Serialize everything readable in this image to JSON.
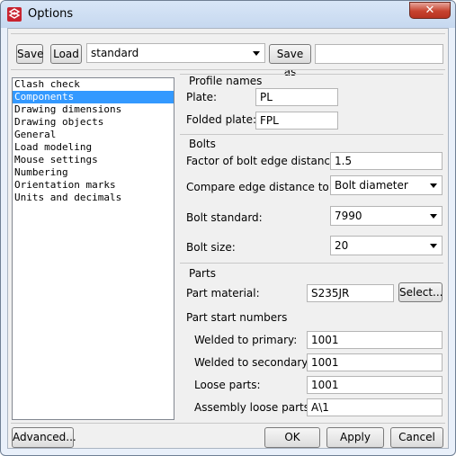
{
  "window": {
    "title": "Options",
    "close_glyph": "✕"
  },
  "toolbar": {
    "save_label": "Save",
    "load_label": "Load",
    "preset_value": "standard",
    "save_as_label": "Save as",
    "save_as_value": ""
  },
  "categories": [
    {
      "label": "Clash check",
      "selected": false
    },
    {
      "label": "Components",
      "selected": true
    },
    {
      "label": "Drawing dimensions",
      "selected": false
    },
    {
      "label": "Drawing objects",
      "selected": false
    },
    {
      "label": "General",
      "selected": false
    },
    {
      "label": "Load modeling",
      "selected": false
    },
    {
      "label": "Mouse settings",
      "selected": false
    },
    {
      "label": "Numbering",
      "selected": false
    },
    {
      "label": "Orientation marks",
      "selected": false
    },
    {
      "label": "Units and decimals",
      "selected": false
    }
  ],
  "profile_names": {
    "heading": "Profile names",
    "plate_label": "Plate:",
    "plate_value": "PL",
    "folded_label": "Folded plate:",
    "folded_value": "FPL"
  },
  "bolts": {
    "heading": "Bolts",
    "edge_factor_label": "Factor of bolt edge distance:",
    "edge_factor_value": "1.5",
    "compare_label": "Compare edge distance to:",
    "compare_value": "Bolt diameter",
    "standard_label": "Bolt standard:",
    "standard_value": "7990",
    "size_label": "Bolt size:",
    "size_value": "20"
  },
  "parts": {
    "heading": "Parts",
    "material_label": "Part material:",
    "material_value": "S235JR",
    "select_label": "Select...",
    "start_numbers_heading": "Part start numbers",
    "welded_primary_label": "Welded to primary:",
    "welded_primary_value": "1001",
    "welded_secondary_label": "Welded to secondary:",
    "welded_secondary_value": "1001",
    "loose_label": "Loose parts:",
    "loose_value": "1001",
    "assembly_loose_label": "Assembly loose parts:",
    "assembly_loose_value": "A\\1"
  },
  "footer": {
    "advanced_label": "Advanced...",
    "ok_label": "OK",
    "apply_label": "Apply",
    "cancel_label": "Cancel"
  },
  "colors": {
    "selection": "#3399ff",
    "close_button": "#c7432f",
    "titlebar": "#c6d8ef"
  },
  "icons": {
    "app": "tekla-options-icon",
    "close": "close-icon",
    "dropdown": "chevron-down-icon"
  }
}
